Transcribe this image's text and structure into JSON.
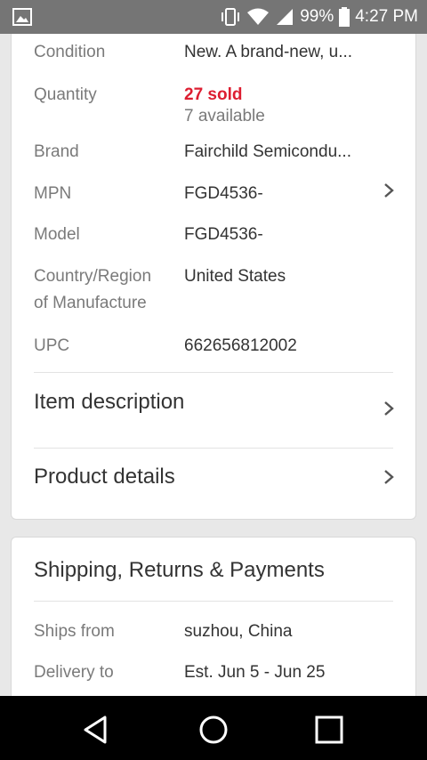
{
  "status_bar": {
    "battery": "99%",
    "time": "4:27 PM"
  },
  "specs": [
    {
      "label": "Condition",
      "value": "New. A brand-new, u..."
    },
    {
      "label": "Quantity",
      "sold": "27 sold",
      "available": "7 available"
    },
    {
      "label": "Brand",
      "value": "Fairchild Semicondu..."
    },
    {
      "label": "MPN",
      "value": "FGD4536-"
    },
    {
      "label": "Model",
      "value": "FGD4536-"
    },
    {
      "label_line1": "Country/Region",
      "label_line2": "of Manufacture",
      "value": "United States"
    },
    {
      "label": "UPC",
      "value": "662656812002"
    }
  ],
  "sections": {
    "item_description": "Item description",
    "product_details": "Product details"
  },
  "shipping": {
    "title": "Shipping, Returns & Payments",
    "ships_from_label": "Ships from",
    "ships_from_value": "suzhou, China",
    "delivery_label": "Delivery to",
    "delivery_value": "Est. Jun 5 - Jun 25"
  }
}
